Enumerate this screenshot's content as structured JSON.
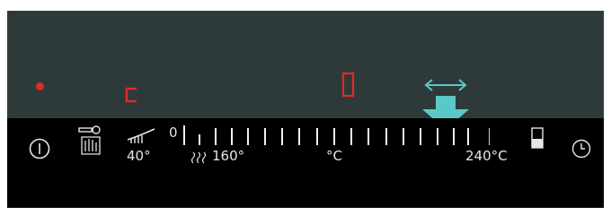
{
  "display": {
    "indicator_color": "#e02a2a",
    "mode_symbol": "c",
    "digit_symbol": "0",
    "swipe_hint_icon": "double-arrow-horizontal-icon",
    "pointer_icon": "down-arrow-pointer-icon",
    "accent": "#5bc8c8"
  },
  "controls": {
    "power_icon": "power-icon",
    "lock_icon": "key-hand-lock-icon",
    "warming_icon": "plate-warming-icon",
    "warming_temp": "40°",
    "defrost_icon": "heat-waves-icon",
    "low_temp": "160°",
    "scale_start": "0",
    "unit": "°C",
    "high_temp": "240°C",
    "door_icon": "oven-door-icon",
    "timer_icon": "clock-icon"
  }
}
